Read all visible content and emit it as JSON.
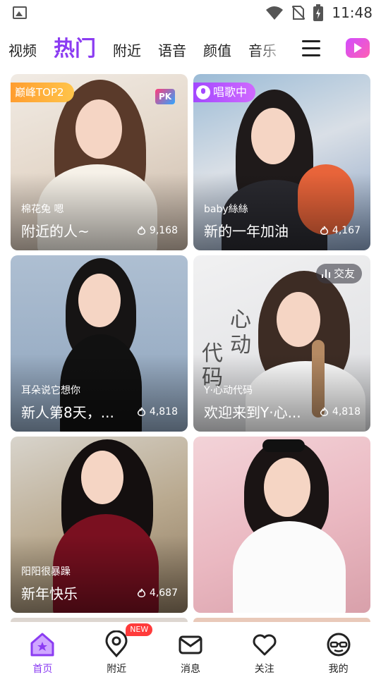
{
  "status_bar": {
    "time": "11:48"
  },
  "top_tabs": [
    {
      "label": "视频",
      "active": false
    },
    {
      "label": "热门",
      "active": true
    },
    {
      "label": "附近",
      "active": false
    },
    {
      "label": "语音",
      "active": false
    },
    {
      "label": "颜值",
      "active": false
    },
    {
      "label": "音乐",
      "active": false
    }
  ],
  "cards": [
    {
      "nickname": "棉花兔 嗯",
      "title": "附近的人~",
      "heat": "9,168",
      "badge": "巅峰TOP2",
      "pk": "PK"
    },
    {
      "nickname": "baby絲絲",
      "title": "新的一年加油",
      "heat": "4,167",
      "badge": "唱歌中"
    },
    {
      "nickname": "耳朵说它想你",
      "title": "新人第8天，...",
      "heat": "4,818"
    },
    {
      "nickname": "Y·心动代码",
      "title": "欢迎来到Y·心...",
      "heat": "4,818",
      "badge": "交友",
      "overlay_text": [
        "心",
        "动",
        "代",
        "码"
      ]
    },
    {
      "nickname": "阳阳很暴躁",
      "title": "新年快乐",
      "heat": "4,687"
    },
    {
      "nickname": "",
      "title": "",
      "heat": ""
    }
  ],
  "bottom_nav": [
    {
      "label": "首页",
      "icon": "home-icon",
      "active": true
    },
    {
      "label": "附近",
      "icon": "location-icon",
      "badge": "NEW"
    },
    {
      "label": "消息",
      "icon": "message-icon"
    },
    {
      "label": "关注",
      "icon": "heart-icon"
    },
    {
      "label": "我的",
      "icon": "profile-icon"
    }
  ],
  "colors": {
    "accent": "#8b3cf2",
    "top_badge": "#ffb03a",
    "sing_badge": "#b157ff",
    "new_badge": "#ff3b3b"
  }
}
